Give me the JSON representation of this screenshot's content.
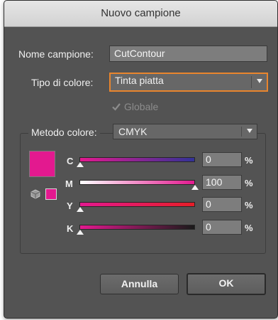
{
  "window": {
    "title": "Nuovo campione"
  },
  "name_row": {
    "label": "Nome campione:",
    "value": "CutContour"
  },
  "color_type": {
    "label": "Tipo di colore:",
    "value": "Tinta piatta"
  },
  "global": {
    "label": "Globale",
    "checked": true,
    "enabled": false
  },
  "color_mode": {
    "label": "Metodo colore:",
    "value": "CMYK"
  },
  "preview_color": "#e3198f",
  "channels": [
    {
      "label": "C",
      "value": "0",
      "unit": "%",
      "fraction": 0.0
    },
    {
      "label": "M",
      "value": "100",
      "unit": "%",
      "fraction": 1.0
    },
    {
      "label": "Y",
      "value": "0",
      "unit": "%",
      "fraction": 0.0
    },
    {
      "label": "K",
      "value": "0",
      "unit": "%",
      "fraction": 0.0
    }
  ],
  "buttons": {
    "cancel": "Annulla",
    "ok": "OK"
  },
  "colors": {
    "accent_focus": "#e9852d",
    "dialog_bg": "#535353",
    "field_bg": "#7d7d7d"
  }
}
